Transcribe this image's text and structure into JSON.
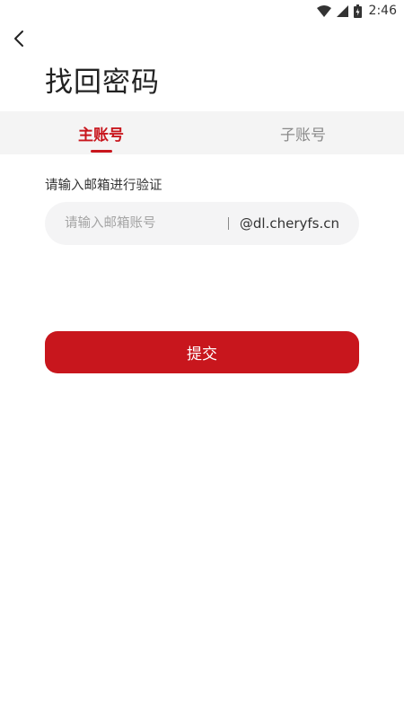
{
  "status_bar": {
    "time": "2:46",
    "icons": [
      "wifi-icon",
      "cell-signal-icon",
      "battery-charging-icon"
    ]
  },
  "header": {
    "back_icon": "chevron-left-icon",
    "title": "找回密码"
  },
  "tabs": [
    {
      "label": "主账号",
      "active": true
    },
    {
      "label": "子账号",
      "active": false
    }
  ],
  "form": {
    "hint": "请输入邮箱进行验证",
    "email_value": "",
    "email_placeholder": "请输入邮箱账号",
    "email_suffix": "@dl.cheryfs.cn",
    "submit_label": "提交"
  },
  "colors": {
    "accent": "#c8161d",
    "tab_bar_bg": "#f4f4f4",
    "input_bg": "#f4f4f5"
  }
}
